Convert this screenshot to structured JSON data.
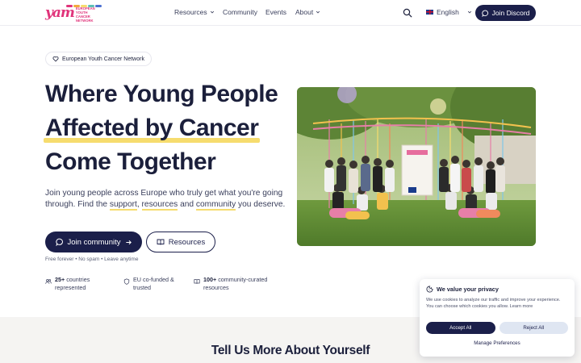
{
  "header": {
    "logo_mark": "yam",
    "logo_sub": "EUROPEAN YOUTH CANCER NETWORK",
    "nav": [
      {
        "label": "Resources",
        "has_dropdown": true
      },
      {
        "label": "Community",
        "has_dropdown": false
      },
      {
        "label": "Events",
        "has_dropdown": false
      },
      {
        "label": "About",
        "has_dropdown": true
      }
    ],
    "language": "English",
    "discord_label": "Join Discord"
  },
  "hero": {
    "badge": "European Youth Cancer Network",
    "headline": [
      "Where Young People",
      "Affected by Cancer",
      "Come Together"
    ],
    "intro_parts": [
      "Join young people across Europe who truly get what you're going through. Find the ",
      "support",
      ", ",
      "resources",
      " and ",
      "community",
      " you deserve."
    ],
    "join_label": "Join community",
    "resources_label": "Resources",
    "fine_print": "Free forever • No spam • Leave anytime",
    "stats": [
      {
        "strong": "25+",
        "text": " countries represented",
        "icon": "users-icon"
      },
      {
        "strong": "",
        "text": "EU co-funded & trusted",
        "icon": "shield-icon"
      },
      {
        "strong": "100+",
        "text": " community-curated resources",
        "icon": "book-icon"
      }
    ]
  },
  "lower": {
    "title": "Tell Us More About Yourself"
  },
  "cookie": {
    "title": "We value your privacy",
    "body": "We use cookies to analyze our traffic and improve your experience. You can choose which cookies you allow.",
    "learn_more": "Learn more",
    "accept": "Accept All",
    "reject": "Reject All",
    "manage": "Manage Preferences"
  },
  "colors": {
    "navy": "#1b1f4a",
    "brand_pink": "#e0337a",
    "highlight": "#f6dc6e",
    "section_bg": "#f5f4f2"
  }
}
